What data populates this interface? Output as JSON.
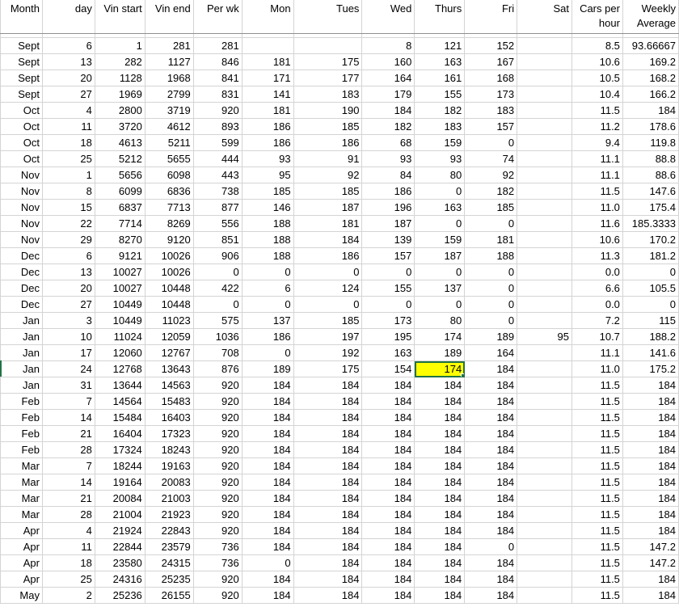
{
  "headers": [
    "Month",
    "day",
    "Vin start",
    "Vin end",
    "Per wk",
    "Mon",
    "Tues",
    "Wed",
    "Thurs",
    "Fri",
    "Sat",
    "Cars per hour",
    "Weekly Average"
  ],
  "header_cars_per_hour": [
    "Cars per",
    "hour"
  ],
  "header_weekly_average": [
    "Weekly",
    "Average"
  ],
  "selected_cell": {
    "row": 20,
    "col": 8,
    "fill": "#ffff00",
    "border": "#217346"
  },
  "rows": [
    [
      "Sept",
      "6",
      "1",
      "281",
      "281",
      "",
      "",
      "8",
      "121",
      "152",
      "",
      "8.5",
      "93.66667"
    ],
    [
      "Sept",
      "13",
      "282",
      "1127",
      "846",
      "181",
      "175",
      "160",
      "163",
      "167",
      "",
      "10.6",
      "169.2"
    ],
    [
      "Sept",
      "20",
      "1128",
      "1968",
      "841",
      "171",
      "177",
      "164",
      "161",
      "168",
      "",
      "10.5",
      "168.2"
    ],
    [
      "Sept",
      "27",
      "1969",
      "2799",
      "831",
      "141",
      "183",
      "179",
      "155",
      "173",
      "",
      "10.4",
      "166.2"
    ],
    [
      "Oct",
      "4",
      "2800",
      "3719",
      "920",
      "181",
      "190",
      "184",
      "182",
      "183",
      "",
      "11.5",
      "184"
    ],
    [
      "Oct",
      "11",
      "3720",
      "4612",
      "893",
      "186",
      "185",
      "182",
      "183",
      "157",
      "",
      "11.2",
      "178.6"
    ],
    [
      "Oct",
      "18",
      "4613",
      "5211",
      "599",
      "186",
      "186",
      "68",
      "159",
      "0",
      "",
      "9.4",
      "119.8"
    ],
    [
      "Oct",
      "25",
      "5212",
      "5655",
      "444",
      "93",
      "91",
      "93",
      "93",
      "74",
      "",
      "11.1",
      "88.8"
    ],
    [
      "Nov",
      "1",
      "5656",
      "6098",
      "443",
      "95",
      "92",
      "84",
      "80",
      "92",
      "",
      "11.1",
      "88.6"
    ],
    [
      "Nov",
      "8",
      "6099",
      "6836",
      "738",
      "185",
      "185",
      "186",
      "0",
      "182",
      "",
      "11.5",
      "147.6"
    ],
    [
      "Nov",
      "15",
      "6837",
      "7713",
      "877",
      "146",
      "187",
      "196",
      "163",
      "185",
      "",
      "11.0",
      "175.4"
    ],
    [
      "Nov",
      "22",
      "7714",
      "8269",
      "556",
      "188",
      "181",
      "187",
      "0",
      "0",
      "",
      "11.6",
      "185.3333"
    ],
    [
      "Nov",
      "29",
      "8270",
      "9120",
      "851",
      "188",
      "184",
      "139",
      "159",
      "181",
      "",
      "10.6",
      "170.2"
    ],
    [
      "Dec",
      "6",
      "9121",
      "10026",
      "906",
      "188",
      "186",
      "157",
      "187",
      "188",
      "",
      "11.3",
      "181.2"
    ],
    [
      "Dec",
      "13",
      "10027",
      "10026",
      "0",
      "0",
      "0",
      "0",
      "0",
      "0",
      "",
      "0.0",
      "0"
    ],
    [
      "Dec",
      "20",
      "10027",
      "10448",
      "422",
      "6",
      "124",
      "155",
      "137",
      "0",
      "",
      "6.6",
      "105.5"
    ],
    [
      "Dec",
      "27",
      "10449",
      "10448",
      "0",
      "0",
      "0",
      "0",
      "0",
      "0",
      "",
      "0.0",
      "0"
    ],
    [
      "Jan",
      "3",
      "10449",
      "11023",
      "575",
      "137",
      "185",
      "173",
      "80",
      "0",
      "",
      "7.2",
      "115"
    ],
    [
      "Jan",
      "10",
      "11024",
      "12059",
      "1036",
      "186",
      "197",
      "195",
      "174",
      "189",
      "95",
      "10.7",
      "188.2"
    ],
    [
      "Jan",
      "17",
      "12060",
      "12767",
      "708",
      "0",
      "192",
      "163",
      "189",
      "164",
      "",
      "11.1",
      "141.6"
    ],
    [
      "Jan",
      "24",
      "12768",
      "13643",
      "876",
      "189",
      "175",
      "154",
      "174",
      "184",
      "",
      "11.0",
      "175.2"
    ],
    [
      "Jan",
      "31",
      "13644",
      "14563",
      "920",
      "184",
      "184",
      "184",
      "184",
      "184",
      "",
      "11.5",
      "184"
    ],
    [
      "Feb",
      "7",
      "14564",
      "15483",
      "920",
      "184",
      "184",
      "184",
      "184",
      "184",
      "",
      "11.5",
      "184"
    ],
    [
      "Feb",
      "14",
      "15484",
      "16403",
      "920",
      "184",
      "184",
      "184",
      "184",
      "184",
      "",
      "11.5",
      "184"
    ],
    [
      "Feb",
      "21",
      "16404",
      "17323",
      "920",
      "184",
      "184",
      "184",
      "184",
      "184",
      "",
      "11.5",
      "184"
    ],
    [
      "Feb",
      "28",
      "17324",
      "18243",
      "920",
      "184",
      "184",
      "184",
      "184",
      "184",
      "",
      "11.5",
      "184"
    ],
    [
      "Mar",
      "7",
      "18244",
      "19163",
      "920",
      "184",
      "184",
      "184",
      "184",
      "184",
      "",
      "11.5",
      "184"
    ],
    [
      "Mar",
      "14",
      "19164",
      "20083",
      "920",
      "184",
      "184",
      "184",
      "184",
      "184",
      "",
      "11.5",
      "184"
    ],
    [
      "Mar",
      "21",
      "20084",
      "21003",
      "920",
      "184",
      "184",
      "184",
      "184",
      "184",
      "",
      "11.5",
      "184"
    ],
    [
      "Mar",
      "28",
      "21004",
      "21923",
      "920",
      "184",
      "184",
      "184",
      "184",
      "184",
      "",
      "11.5",
      "184"
    ],
    [
      "Apr",
      "4",
      "21924",
      "22843",
      "920",
      "184",
      "184",
      "184",
      "184",
      "184",
      "",
      "11.5",
      "184"
    ],
    [
      "Apr",
      "11",
      "22844",
      "23579",
      "736",
      "184",
      "184",
      "184",
      "184",
      "0",
      "",
      "11.5",
      "147.2"
    ],
    [
      "Apr",
      "18",
      "23580",
      "24315",
      "736",
      "0",
      "184",
      "184",
      "184",
      "184",
      "",
      "11.5",
      "147.2"
    ],
    [
      "Apr",
      "25",
      "24316",
      "25235",
      "920",
      "184",
      "184",
      "184",
      "184",
      "184",
      "",
      "11.5",
      "184"
    ],
    [
      "May",
      "2",
      "25236",
      "26155",
      "920",
      "184",
      "184",
      "184",
      "184",
      "184",
      "",
      "11.5",
      "184"
    ]
  ]
}
